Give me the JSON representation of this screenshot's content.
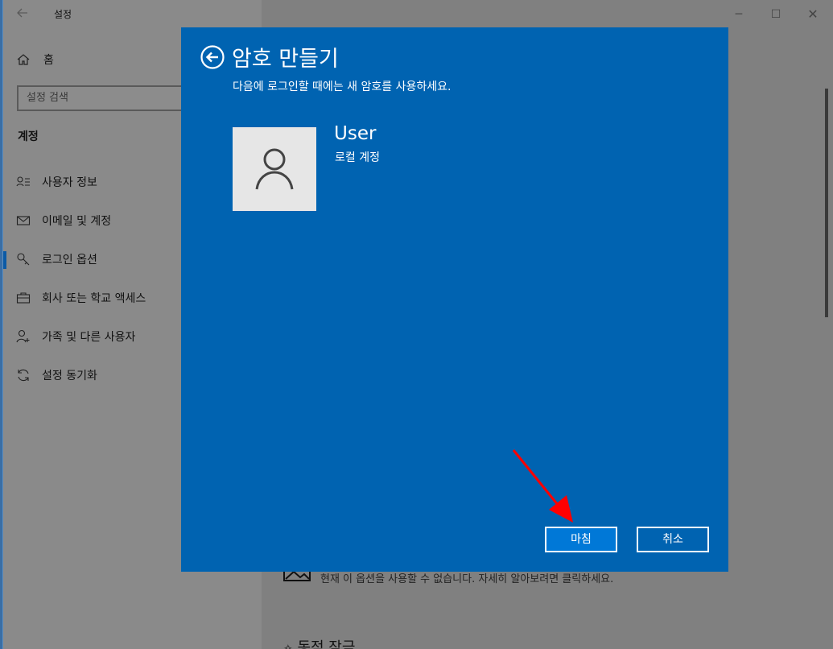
{
  "window": {
    "title": "설정",
    "back_icon": "arrow-left-icon",
    "controls": {
      "minimize": "─",
      "maximize": "☐",
      "close": "✕"
    }
  },
  "sidebar": {
    "home_label": "홈",
    "search_placeholder": "설정 검색",
    "section_title": "계정",
    "items": [
      {
        "label": "사용자 정보",
        "icon": "user-info-icon"
      },
      {
        "label": "이메일 및 계정",
        "icon": "mail-icon"
      },
      {
        "label": "로그인 옵션",
        "icon": "key-icon",
        "selected": true
      },
      {
        "label": "회사 또는 학교 액세스",
        "icon": "briefcase-icon"
      },
      {
        "label": "가족 및 다른 사용자",
        "icon": "person-add-icon"
      },
      {
        "label": "설정 동기화",
        "icon": "sync-icon"
      }
    ]
  },
  "main_behind": {
    "option_text": "현재 이 옵션을 사용할 수 없습니다. 자세히 알아보려면 클릭하세요.",
    "next_heading": "동적 잠금"
  },
  "dialog": {
    "title": "암호 만들기",
    "subtitle": "다음에 로그인할 때에는 새 암호를 사용하세요.",
    "user_name": "User",
    "account_type": "로컬 계정",
    "finish_button": "마침",
    "cancel_button": "취소",
    "background_color": "#0063b1",
    "finish_button_color": "#0078d7"
  },
  "annotation": {
    "arrow_color": "#ff0000"
  }
}
